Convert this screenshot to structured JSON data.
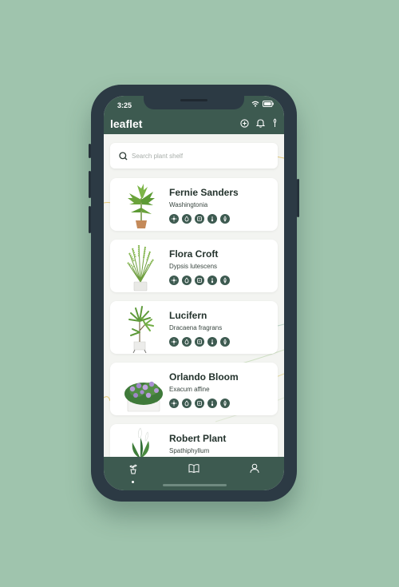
{
  "status": {
    "time": "3:25"
  },
  "app": {
    "title": "leaflet"
  },
  "search": {
    "placeholder": "Search plant shelf"
  },
  "plants": [
    {
      "name": "Fernie Sanders",
      "species": "Washingtonia"
    },
    {
      "name": "Flora Croft",
      "species": "Dypsis lutescens"
    },
    {
      "name": "Lucifern",
      "species": "Dracaena fragrans"
    },
    {
      "name": "Orlando Bloom",
      "species": "Exacum affine"
    },
    {
      "name": "Robert Plant",
      "species": "Spathiphyllum"
    }
  ],
  "attribute_icons": [
    "sun-icon",
    "water-drop-icon",
    "thermometer-icon",
    "pot-icon",
    "leaf-icon"
  ],
  "header_icons": [
    "add-circle-icon",
    "bell-icon",
    "leaf-pin-icon"
  ],
  "tabs": [
    "plant-shelf-tab",
    "guide-book-tab",
    "profile-tab"
  ],
  "colors": {
    "primary": "#3d5a50",
    "background": "#9fc4ad",
    "card": "#ffffff",
    "content_bg": "#f3f4f1"
  }
}
